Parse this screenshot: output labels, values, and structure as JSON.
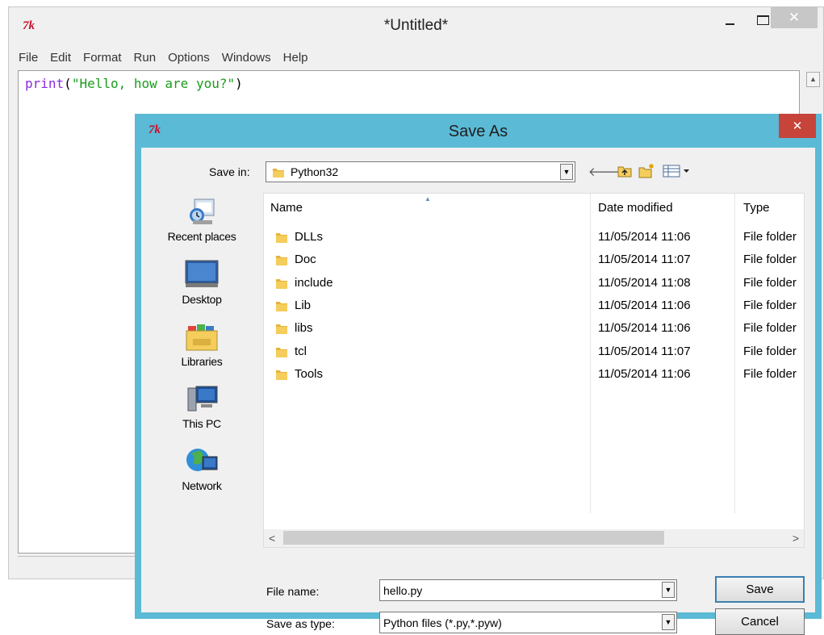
{
  "idle": {
    "title": "*Untitled*",
    "menu": [
      "File",
      "Edit",
      "Format",
      "Run",
      "Options",
      "Windows",
      "Help"
    ],
    "code": {
      "keyword": "print",
      "open": "(",
      "string": "\"Hello, how are you?\"",
      "close": ")"
    }
  },
  "dialog": {
    "title": "Save As",
    "save_in_label": "Save in:",
    "save_in_value": "Python32",
    "places": [
      "Recent places",
      "Desktop",
      "Libraries",
      "This PC",
      "Network"
    ],
    "columns": {
      "name": "Name",
      "date": "Date modified",
      "type": "Type"
    },
    "files": [
      {
        "name": "DLLs",
        "date": "11/05/2014 11:06",
        "type": "File folder"
      },
      {
        "name": "Doc",
        "date": "11/05/2014 11:07",
        "type": "File folder"
      },
      {
        "name": "include",
        "date": "11/05/2014 11:08",
        "type": "File folder"
      },
      {
        "name": "Lib",
        "date": "11/05/2014 11:06",
        "type": "File folder"
      },
      {
        "name": "libs",
        "date": "11/05/2014 11:06",
        "type": "File folder"
      },
      {
        "name": "tcl",
        "date": "11/05/2014 11:07",
        "type": "File folder"
      },
      {
        "name": "Tools",
        "date": "11/05/2014 11:06",
        "type": "File folder"
      }
    ],
    "file_name_label": "File name:",
    "file_name_value": "hello.py",
    "save_type_label": "Save as type:",
    "save_type_value": "Python files (*.py,*.pyw)",
    "save_button": "Save",
    "cancel_button": "Cancel"
  },
  "icons": {
    "app": "tk-feather-logo",
    "folder": "folder-icon",
    "back": "back-arrow-icon",
    "up": "up-folder-icon",
    "new_folder": "new-folder-icon",
    "views": "views-menu-icon"
  },
  "colors": {
    "dialog_frame": "#5bbad5",
    "dialog_close": "#c7443a",
    "keyword": "#8a2be2",
    "string": "#1a9c1a",
    "tk_logo": "#c8102e"
  }
}
